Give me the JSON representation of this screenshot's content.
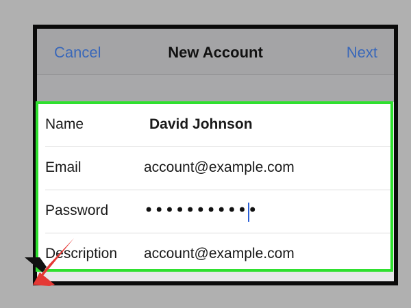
{
  "navbar": {
    "cancel_label": "Cancel",
    "title": "New Account",
    "next_label": "Next"
  },
  "form": {
    "rows": [
      {
        "label": "Name",
        "value": "David Johnson"
      },
      {
        "label": "Email",
        "value": "account@example.com"
      },
      {
        "label": "Password",
        "value": "•••••••••••"
      },
      {
        "label": "Description",
        "value": "account@example.com"
      }
    ]
  },
  "colors": {
    "accent": "#3a68b9",
    "highlight_border": "#2fe02f",
    "logo_red": "#e53935",
    "logo_black": "#111111",
    "caret": "#2a5fd6"
  },
  "icons": {
    "logo": "x-logo-icon"
  }
}
